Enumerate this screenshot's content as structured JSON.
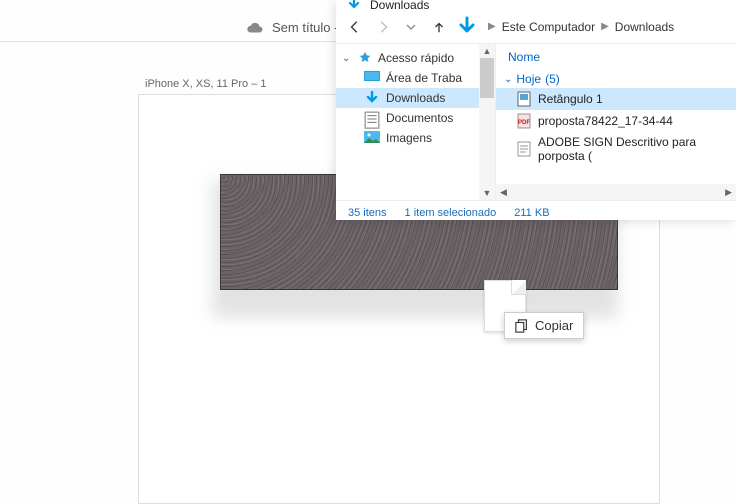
{
  "design": {
    "tab_untitled": "Sem título -",
    "artboard_label": "iPhone X, XS, 11 Pro – 1"
  },
  "drag": {
    "copy_label": "Copiar"
  },
  "explorer": {
    "title": "Downloads",
    "breadcrumb": {
      "pc": "Este Computador",
      "folder": "Downloads"
    },
    "sidebar": {
      "quick_access": "Acesso rápido",
      "items": [
        {
          "label": "Área de Traba"
        },
        {
          "label": "Downloads"
        },
        {
          "label": "Documentos"
        },
        {
          "label": "Imagens"
        }
      ]
    },
    "columns": {
      "name": "Nome"
    },
    "group": {
      "label": "Hoje",
      "count": "(5)"
    },
    "files": [
      {
        "name": "Retângulo 1",
        "type": "image"
      },
      {
        "name": "proposta78422_17-34-44",
        "type": "pdf"
      },
      {
        "name": "ADOBE SIGN Descritivo para porposta (",
        "type": "txt"
      }
    ],
    "status": {
      "items": "35 itens",
      "selected": "1 item selecionado",
      "size": "211 KB"
    }
  }
}
